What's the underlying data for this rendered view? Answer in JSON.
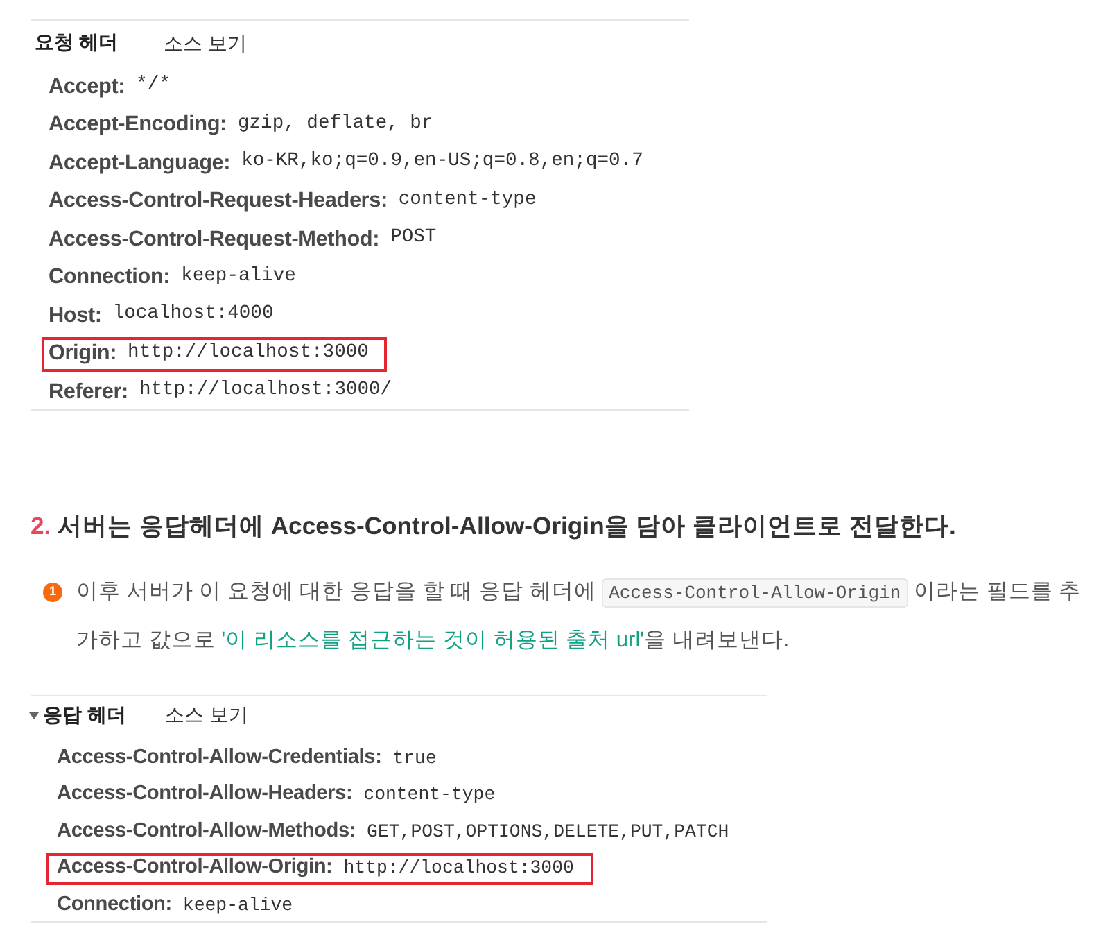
{
  "request_panel": {
    "title": "요청 헤더",
    "view_source": "소스 보기",
    "headers": [
      {
        "name": "Accept:",
        "value": "*/*",
        "highlighted": false
      },
      {
        "name": "Accept-Encoding:",
        "value": "gzip, deflate, br",
        "highlighted": false
      },
      {
        "name": "Accept-Language:",
        "value": "ko-KR,ko;q=0.9,en-US;q=0.8,en;q=0.7",
        "highlighted": false
      },
      {
        "name": "Access-Control-Request-Headers:",
        "value": "content-type",
        "highlighted": false
      },
      {
        "name": "Access-Control-Request-Method:",
        "value": "POST",
        "highlighted": false
      },
      {
        "name": "Connection:",
        "value": "keep-alive",
        "highlighted": false
      },
      {
        "name": "Host:",
        "value": "localhost:4000",
        "highlighted": false
      },
      {
        "name": "Origin:",
        "value": "http://localhost:3000",
        "highlighted": true
      },
      {
        "name": "Referer:",
        "value": "http://localhost:3000/",
        "highlighted": false
      }
    ]
  },
  "section": {
    "number": "2.",
    "heading": "서버는 응답헤더에 Access-Control-Allow-Origin을 담아 클라이언트로 전달한다."
  },
  "note": {
    "badge": "1",
    "parts": [
      {
        "kind": "text",
        "text": "이후 서버가 이 요청에 대한 응답을 할 때 응답 헤더에 "
      },
      {
        "kind": "code",
        "text": "Access-Control-Allow-Origin"
      },
      {
        "kind": "text",
        "text": " 이라는 필드를 추가하고 값으로 "
      },
      {
        "kind": "accent",
        "text": "'이 리소스를 접근하는 것이 허용된 출처 url'"
      },
      {
        "kind": "text",
        "text": "을 내려보낸다."
      }
    ]
  },
  "response_panel": {
    "expanded": true,
    "title": "응답 헤더",
    "view_source": "소스 보기",
    "headers": [
      {
        "name": "Access-Control-Allow-Credentials:",
        "value": "true",
        "highlighted": false
      },
      {
        "name": "Access-Control-Allow-Headers:",
        "value": "content-type",
        "highlighted": false
      },
      {
        "name": "Access-Control-Allow-Methods:",
        "value": "GET,POST,OPTIONS,DELETE,PUT,PATCH",
        "highlighted": false
      },
      {
        "name": "Access-Control-Allow-Origin:",
        "value": "http://localhost:3000",
        "highlighted": true
      },
      {
        "name": "Connection:",
        "value": "keep-alive",
        "highlighted": false
      }
    ]
  }
}
